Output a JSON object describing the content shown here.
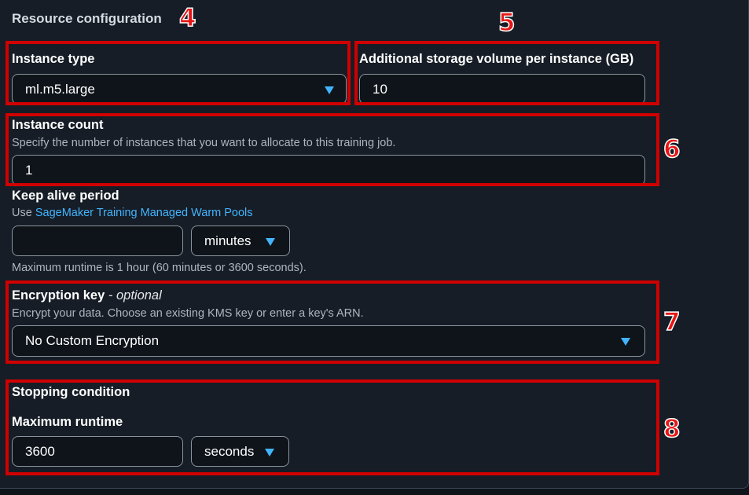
{
  "section": {
    "title": "Resource configuration"
  },
  "instance_type": {
    "label": "Instance type",
    "value": "ml.m5.large"
  },
  "storage": {
    "label": "Additional storage volume per instance (GB)",
    "value": "10"
  },
  "instance_count": {
    "label": "Instance count",
    "description": "Specify the number of instances that you want to allocate to this training job.",
    "value": "1"
  },
  "keep_alive": {
    "label": "Keep alive period",
    "use_prefix": "Use",
    "link_text": "SageMaker Training Managed Warm Pools",
    "value": "",
    "unit": "minutes",
    "hint": "Maximum runtime is 1 hour (60 minutes or 3600 seconds)."
  },
  "encryption": {
    "label": "Encryption key",
    "optional_suffix": "- optional",
    "description": "Encrypt your data. Choose an existing KMS key or enter a key's ARN.",
    "value": "No Custom Encryption"
  },
  "stopping": {
    "title": "Stopping condition",
    "max_runtime_label": "Maximum runtime",
    "value": "3600",
    "unit": "seconds"
  },
  "annotations": {
    "labels": [
      "4",
      "5",
      "6",
      "7",
      "8"
    ],
    "color": "#d00000"
  },
  "colors": {
    "background": "#161d26",
    "accent": "#42b4ff",
    "highlight": "#d00000"
  }
}
